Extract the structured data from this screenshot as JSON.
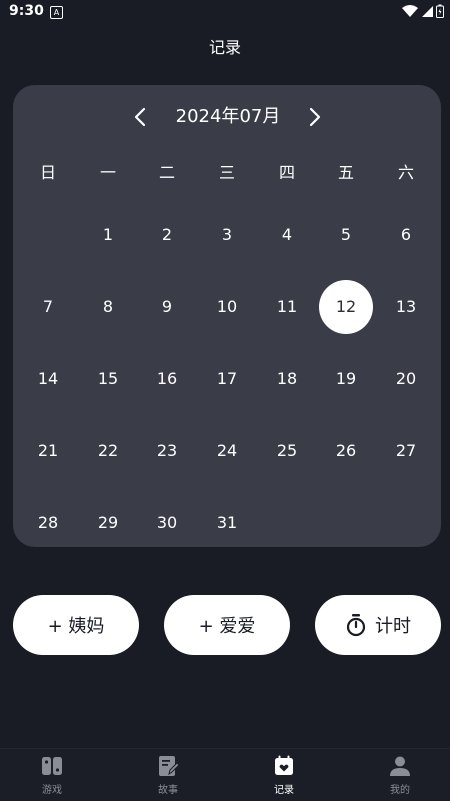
{
  "status_bar": {
    "time": "9:30",
    "notification_icon": "A"
  },
  "header": {
    "title": "记录"
  },
  "calendar": {
    "month_label": "2024年07月",
    "weekdays": [
      "日",
      "一",
      "二",
      "三",
      "四",
      "五",
      "六"
    ],
    "days": [
      "1",
      "2",
      "3",
      "4",
      "5",
      "6",
      "7",
      "8",
      "9",
      "10",
      "11",
      "12",
      "13",
      "14",
      "15",
      "16",
      "17",
      "18",
      "19",
      "20",
      "21",
      "22",
      "23",
      "24",
      "25",
      "26",
      "27",
      "28",
      "29",
      "30",
      "31"
    ],
    "selected_day": "12"
  },
  "actions": {
    "period_label": "+ 姨妈",
    "love_label": "+ 爱爱",
    "timer_label": "计时"
  },
  "nav": {
    "items": [
      {
        "label": "游戏",
        "icon": "game-icon"
      },
      {
        "label": "故事",
        "icon": "story-icon"
      },
      {
        "label": "记录",
        "icon": "calendar-icon"
      },
      {
        "label": "我的",
        "icon": "profile-icon"
      }
    ],
    "active": "记录"
  },
  "colors": {
    "background": "#1a1c25",
    "card": "#3a3c48",
    "accent": "#ffffff"
  }
}
